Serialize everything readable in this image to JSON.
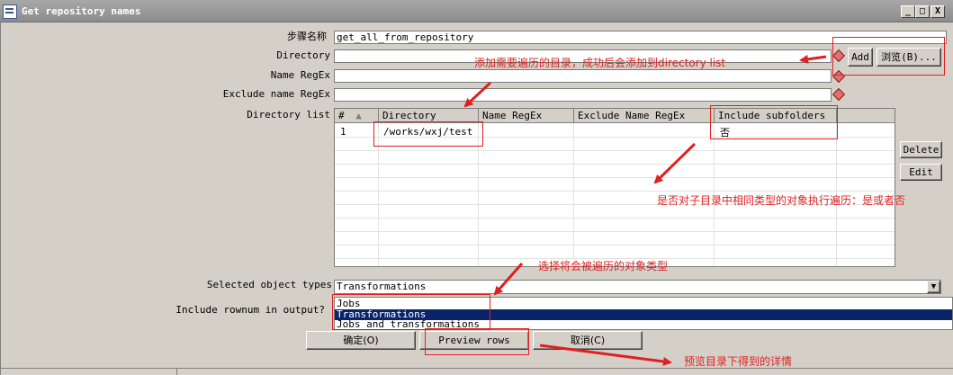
{
  "window": {
    "title": "Get repository names",
    "minimize": "_",
    "maximize": "□",
    "close": "X"
  },
  "form": {
    "step_name_label": "步骤名称",
    "step_name_value": "get_all_from_repository",
    "directory_label": "Directory",
    "directory_value": "",
    "name_regex_label": "Name RegEx",
    "name_regex_value": "",
    "exclude_regex_label": "Exclude name RegEx",
    "exclude_regex_value": "",
    "directory_list_label": "Directory list",
    "add_button": "Add",
    "browse_button": "浏览(B)...",
    "delete_button": "Delete",
    "edit_button": "Edit",
    "selected_types_label": "Selected object types",
    "selected_types_value": "Transformations",
    "rownum_label": "Include rownum in output?"
  },
  "table": {
    "columns": [
      "#",
      "Directory",
      "Name RegEx",
      "Exclude Name RegEx",
      "Include subfolders"
    ],
    "rows": [
      {
        "num": "1",
        "directory": "/works/wxj/test",
        "name_regex": "",
        "exclude_regex": "",
        "include_subfolders": "否"
      }
    ]
  },
  "dropdown": {
    "options": [
      "Jobs",
      "Transformations",
      "Jobs and transformations"
    ],
    "selected_index": 1
  },
  "buttons": {
    "ok": "确定(O)",
    "preview": "Preview rows",
    "cancel": "取消(C)"
  },
  "annotations": {
    "add_note": "添加需要遍历的目录，成功后会添加到directory list",
    "subfolder_note": "是否对子目录中相同类型的对象执行遍历：是或者否",
    "type_note": "选择将会被遍历的对象类型",
    "preview_note": "预览目录下得到的详情"
  },
  "colors": {
    "annotation_red": "#e02020",
    "selection_blue": "#0a246a"
  }
}
